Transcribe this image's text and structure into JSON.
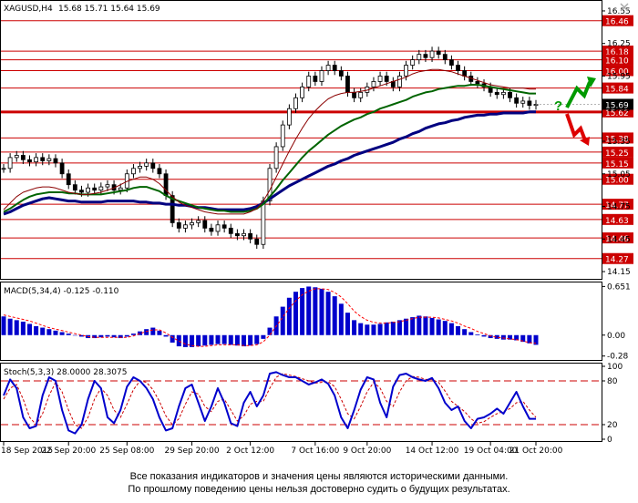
{
  "window": {
    "title": "XAGUSD,H4",
    "ohlc": "15.68 15.71 15.64 15.69"
  },
  "chart_data": {
    "type": "line",
    "symbol": "XAGUSD",
    "timeframe": "H4",
    "price_panel": {
      "ylim": [
        14.1,
        16.6
      ],
      "y_ticks": [
        "16.55",
        "16.25",
        "15.95",
        "15.65",
        "15.35",
        "15.05",
        "14.75",
        "14.45",
        "14.15"
      ],
      "last_price": "15.69",
      "levels": [
        {
          "value": 16.46,
          "label": "16.46"
        },
        {
          "value": 16.18,
          "label": "16.18"
        },
        {
          "value": 16.1,
          "label": "16.10"
        },
        {
          "value": 16.0,
          "label": "16.00"
        },
        {
          "value": 15.84,
          "label": "15.84"
        },
        {
          "value": 15.62,
          "label": "15.62"
        },
        {
          "value": 15.38,
          "label": "15.38"
        },
        {
          "value": 15.25,
          "label": "15.25"
        },
        {
          "value": 15.15,
          "label": "15.15"
        },
        {
          "value": 15.0,
          "label": "15.00"
        },
        {
          "value": 14.77,
          "label": "14.77"
        },
        {
          "value": 14.63,
          "label": "14.63"
        },
        {
          "value": 14.46,
          "label": "14.46"
        },
        {
          "value": 14.27,
          "label": "14.27"
        }
      ],
      "close": [
        15.1,
        15.2,
        15.22,
        15.18,
        15.16,
        15.2,
        15.17,
        15.19,
        15.15,
        15.05,
        14.95,
        14.9,
        14.88,
        14.92,
        14.9,
        14.93,
        14.95,
        14.9,
        14.92,
        15.05,
        15.1,
        15.12,
        15.15,
        15.1,
        15.05,
        14.85,
        14.6,
        14.55,
        14.58,
        14.6,
        14.62,
        14.55,
        14.52,
        14.58,
        14.55,
        14.5,
        14.48,
        14.5,
        14.45,
        14.4,
        14.8,
        15.1,
        15.3,
        15.5,
        15.65,
        15.75,
        15.85,
        15.95,
        15.9,
        16.0,
        16.05,
        16.0,
        15.95,
        15.8,
        15.75,
        15.8,
        15.85,
        15.9,
        15.95,
        15.9,
        15.85,
        15.95,
        16.05,
        16.1,
        16.15,
        16.12,
        16.18,
        16.15,
        16.1,
        16.05,
        16.0,
        15.95,
        15.9,
        15.88,
        15.85,
        15.8,
        15.78,
        15.8,
        15.75,
        15.7,
        15.72,
        15.68,
        15.69
      ],
      "series": [
        {
          "name": "",
          "color": "#000080",
          "width": 3,
          "values": [
            14.68,
            14.7,
            14.73,
            14.76,
            14.78,
            14.8,
            14.82,
            14.83,
            14.82,
            14.81,
            14.8,
            14.8,
            14.79,
            14.79,
            14.79,
            14.79,
            14.8,
            14.8,
            14.8,
            14.8,
            14.8,
            14.79,
            14.79,
            14.78,
            14.78,
            14.77,
            14.77,
            14.76,
            14.76,
            14.75,
            14.74,
            14.74,
            14.73,
            14.72,
            14.72,
            14.72,
            14.72,
            14.72,
            14.73,
            14.75,
            14.78,
            14.82,
            14.86,
            14.9,
            14.94,
            14.97,
            15.0,
            15.03,
            15.06,
            15.09,
            15.12,
            15.14,
            15.17,
            15.19,
            15.22,
            15.24,
            15.26,
            15.28,
            15.3,
            15.32,
            15.34,
            15.37,
            15.39,
            15.42,
            15.44,
            15.47,
            15.49,
            15.51,
            15.52,
            15.54,
            15.55,
            15.57,
            15.58,
            15.59,
            15.59,
            15.6,
            15.6,
            15.61,
            15.61,
            15.61,
            15.61,
            15.62,
            15.62
          ]
        },
        {
          "name": "",
          "color": "#006400",
          "width": 2,
          "values": [
            14.7,
            14.73,
            14.77,
            14.81,
            14.84,
            14.86,
            14.87,
            14.88,
            14.88,
            14.88,
            14.87,
            14.87,
            14.86,
            14.86,
            14.86,
            14.86,
            14.87,
            14.88,
            14.89,
            14.9,
            14.92,
            14.93,
            14.93,
            14.91,
            14.89,
            14.85,
            14.82,
            14.8,
            14.78,
            14.76,
            14.74,
            14.73,
            14.72,
            14.71,
            14.71,
            14.7,
            14.7,
            14.7,
            14.71,
            14.73,
            14.77,
            14.84,
            14.91,
            14.99,
            15.06,
            15.13,
            15.2,
            15.26,
            15.31,
            15.36,
            15.41,
            15.45,
            15.49,
            15.52,
            15.55,
            15.57,
            15.6,
            15.62,
            15.65,
            15.67,
            15.69,
            15.71,
            15.73,
            15.76,
            15.78,
            15.8,
            15.81,
            15.83,
            15.84,
            15.85,
            15.86,
            15.86,
            15.87,
            15.87,
            15.86,
            15.85,
            15.84,
            15.83,
            15.82,
            15.81,
            15.8,
            15.79,
            15.79
          ]
        },
        {
          "name": "",
          "color": "#8b0000",
          "width": 1,
          "values": [
            14.72,
            14.78,
            14.84,
            14.88,
            14.9,
            14.92,
            14.93,
            14.93,
            14.92,
            14.9,
            14.88,
            14.87,
            14.86,
            14.86,
            14.87,
            14.88,
            14.9,
            14.92,
            14.95,
            14.98,
            15.0,
            15.02,
            15.02,
            15.0,
            14.96,
            14.9,
            14.84,
            14.79,
            14.76,
            14.74,
            14.72,
            14.7,
            14.69,
            14.68,
            14.68,
            14.68,
            14.68,
            14.68,
            14.7,
            14.73,
            14.8,
            14.9,
            15.02,
            15.14,
            15.26,
            15.37,
            15.47,
            15.56,
            15.63,
            15.69,
            15.74,
            15.77,
            15.79,
            15.8,
            15.8,
            15.81,
            15.82,
            15.84,
            15.86,
            15.88,
            15.9,
            15.92,
            15.94,
            15.97,
            15.99,
            16.0,
            16.01,
            16.01,
            16.0,
            15.99,
            15.97,
            15.95,
            15.93,
            15.91,
            15.89,
            15.87,
            15.86,
            15.85,
            15.84,
            15.84,
            15.84,
            15.83,
            15.83
          ]
        }
      ],
      "annotations": {
        "question_mark": "?"
      }
    },
    "macd_panel": {
      "label": "MACD(5,34,4) -0.125 -0.110",
      "ylim": [
        -0.32,
        0.68
      ],
      "y_ticks": [
        "0.651",
        "0.00",
        "-0.28"
      ],
      "histogram": [
        0.25,
        0.22,
        0.2,
        0.18,
        0.15,
        0.12,
        0.1,
        0.08,
        0.06,
        0.04,
        0.02,
        0.0,
        -0.02,
        -0.04,
        -0.04,
        -0.03,
        -0.02,
        -0.03,
        -0.04,
        -0.02,
        0.02,
        0.05,
        0.08,
        0.1,
        0.06,
        -0.02,
        -0.1,
        -0.15,
        -0.16,
        -0.16,
        -0.15,
        -0.14,
        -0.13,
        -0.12,
        -0.12,
        -0.13,
        -0.14,
        -0.15,
        -0.14,
        -0.12,
        -0.05,
        0.1,
        0.25,
        0.38,
        0.5,
        0.58,
        0.63,
        0.65,
        0.64,
        0.62,
        0.58,
        0.52,
        0.42,
        0.3,
        0.2,
        0.16,
        0.14,
        0.14,
        0.15,
        0.17,
        0.18,
        0.2,
        0.22,
        0.24,
        0.26,
        0.25,
        0.23,
        0.21,
        0.19,
        0.16,
        0.12,
        0.08,
        0.04,
        0.01,
        -0.02,
        -0.04,
        -0.05,
        -0.06,
        -0.06,
        -0.07,
        -0.09,
        -0.11,
        -0.13
      ],
      "signal": [
        0.27,
        0.25,
        0.23,
        0.21,
        0.19,
        0.16,
        0.13,
        0.1,
        0.08,
        0.06,
        0.04,
        0.02,
        0.0,
        -0.02,
        -0.03,
        -0.03,
        -0.03,
        -0.03,
        -0.03,
        -0.03,
        -0.01,
        0.02,
        0.05,
        0.07,
        0.07,
        0.03,
        -0.03,
        -0.08,
        -0.12,
        -0.14,
        -0.15,
        -0.15,
        -0.14,
        -0.13,
        -0.13,
        -0.13,
        -0.13,
        -0.14,
        -0.14,
        -0.13,
        -0.09,
        0.0,
        0.12,
        0.24,
        0.36,
        0.46,
        0.54,
        0.59,
        0.62,
        0.62,
        0.61,
        0.57,
        0.51,
        0.42,
        0.32,
        0.25,
        0.2,
        0.17,
        0.16,
        0.16,
        0.17,
        0.18,
        0.2,
        0.22,
        0.24,
        0.24,
        0.24,
        0.23,
        0.21,
        0.19,
        0.16,
        0.12,
        0.09,
        0.05,
        0.02,
        -0.01,
        -0.03,
        -0.04,
        -0.05,
        -0.06,
        -0.08,
        -0.1,
        -0.11
      ]
    },
    "stoch_panel": {
      "label": "Stoch(5,3,3) 28.0000 28.3075",
      "ylim": [
        0,
        100
      ],
      "y_ticks": [
        "100",
        "80",
        "20",
        "0"
      ],
      "levels": [
        80,
        20
      ],
      "k": [
        60,
        82,
        70,
        30,
        15,
        18,
        60,
        85,
        80,
        40,
        12,
        8,
        20,
        55,
        80,
        70,
        30,
        22,
        40,
        72,
        85,
        80,
        70,
        55,
        30,
        12,
        15,
        45,
        70,
        75,
        50,
        25,
        45,
        70,
        50,
        22,
        18,
        50,
        65,
        45,
        60,
        90,
        92,
        88,
        85,
        85,
        80,
        75,
        78,
        82,
        76,
        60,
        30,
        15,
        40,
        68,
        85,
        82,
        50,
        30,
        72,
        88,
        90,
        85,
        82,
        80,
        84,
        70,
        50,
        40,
        45,
        25,
        15,
        28,
        30,
        35,
        42,
        35,
        50,
        65,
        45,
        28,
        28
      ],
      "d": [
        55,
        70,
        75,
        55,
        30,
        20,
        35,
        60,
        78,
        65,
        40,
        20,
        15,
        30,
        55,
        70,
        60,
        40,
        30,
        48,
        68,
        80,
        78,
        68,
        52,
        32,
        20,
        28,
        48,
        65,
        62,
        45,
        38,
        52,
        55,
        40,
        25,
        32,
        48,
        52,
        52,
        70,
        85,
        90,
        88,
        86,
        83,
        80,
        77,
        78,
        79,
        72,
        55,
        35,
        28,
        45,
        65,
        78,
        70,
        52,
        45,
        65,
        80,
        86,
        85,
        82,
        82,
        78,
        66,
        52,
        45,
        38,
        28,
        22,
        24,
        30,
        35,
        38,
        42,
        50,
        52,
        40,
        30
      ]
    },
    "x_ticks": [
      "18 Sep 2015",
      "22 Sep 20:00",
      "25 Sep 08:00",
      "29 Sep 20:00",
      "2 Oct 12:00",
      "7 Oct 16:00",
      "9 Oct 20:00",
      "14 Oct 12:00",
      "19 Oct 04:00",
      "21 Oct 20:00"
    ]
  },
  "disclaimer": {
    "line1": "Все показания индикаторов и значения цены являются историческими данными.",
    "line2": "По прошлому поведению цены нельзя достоверно судить о будущих результатах."
  },
  "colors": {
    "level_line": "#cc0000",
    "macd_bars": "#0000cc",
    "signal_line": "#ff0000",
    "stoch_main": "#0000cc",
    "stoch_signal": "#cc0000",
    "candle": "#000000",
    "up_arrow": "#009900",
    "down_arrow": "#dd0000",
    "question": "#009900"
  }
}
